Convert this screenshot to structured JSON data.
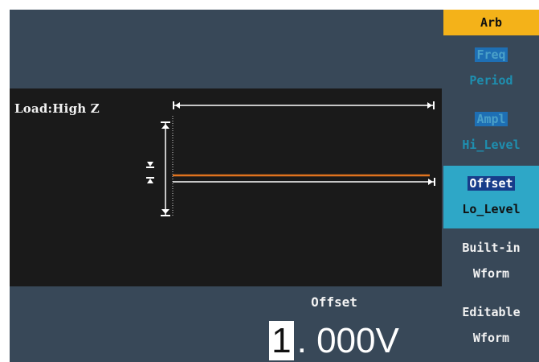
{
  "waveform": {
    "load_label": "Load:High Z"
  },
  "parameter": {
    "name": "Offset",
    "value_cursor_digit": "1",
    "value_rest": ". 000V"
  },
  "menu": {
    "title": "Arb",
    "items": [
      {
        "line1": "Freq",
        "line2": "Period"
      },
      {
        "line1": "Ampl",
        "line2": "Hi_Level"
      },
      {
        "line1": "Offset",
        "line2": "Lo_Level"
      },
      {
        "line1": "Built-in",
        "line2": "Wform"
      },
      {
        "line1": "Editable",
        "line2": "Wform"
      }
    ]
  },
  "colors": {
    "title_accent": "#f4b219",
    "selected_item": "#2ea7c7",
    "waveform_line": "#e0731e",
    "panel": "#384858"
  }
}
